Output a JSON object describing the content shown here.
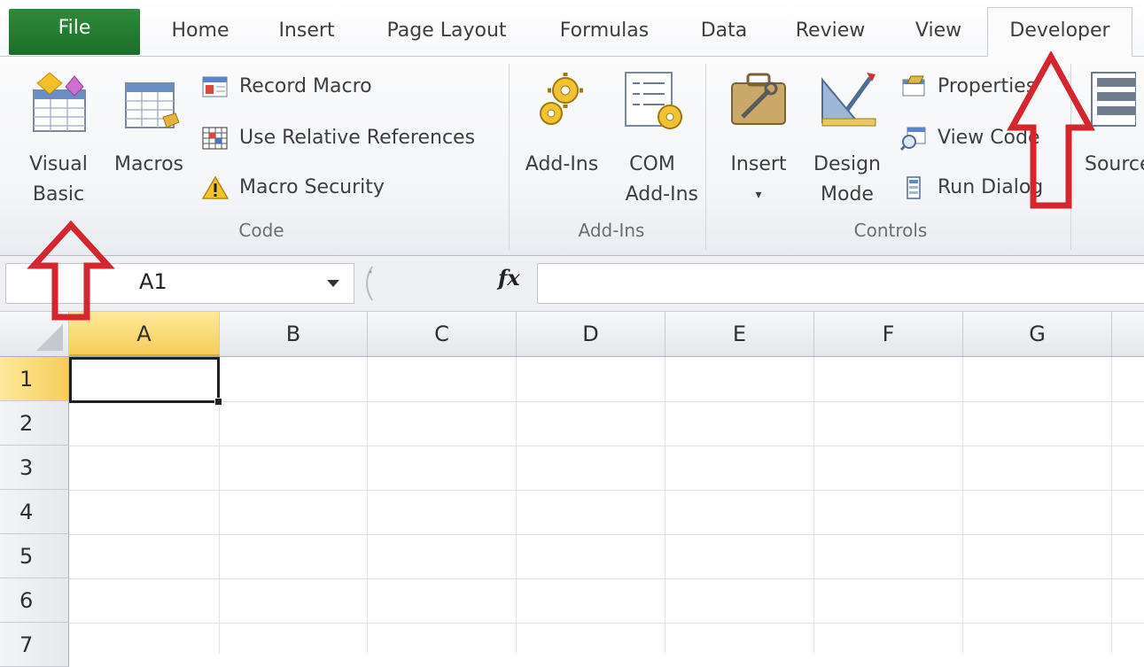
{
  "tabs": {
    "file": "File",
    "home": "Home",
    "insert": "Insert",
    "page_layout": "Page Layout",
    "formulas": "Formulas",
    "data": "Data",
    "review": "Review",
    "view": "View",
    "developer": "Developer"
  },
  "ribbon": {
    "code": {
      "label": "Code",
      "visual_basic": [
        "Visual",
        "Basic"
      ],
      "macros": "Macros",
      "record_macro": "Record Macro",
      "use_relative_references": "Use Relative References",
      "macro_security": "Macro Security"
    },
    "addins": {
      "label": "Add-Ins",
      "add_ins": "Add-Ins",
      "com_add_ins": [
        "COM",
        "Add-Ins"
      ]
    },
    "controls": {
      "label": "Controls",
      "insert": "Insert",
      "design_mode": [
        "Design",
        "Mode"
      ],
      "properties": "Properties",
      "view_code": "View Code",
      "run_dialog": "Run Dialog"
    },
    "xml": {
      "source": "Source"
    }
  },
  "formula_bar": {
    "name_box": "A1",
    "fx_label": "fx",
    "formula": ""
  },
  "sheet": {
    "columns": [
      "A",
      "B",
      "C",
      "D",
      "E",
      "F",
      "G"
    ],
    "rows": [
      "1",
      "2",
      "3",
      "4",
      "5",
      "6",
      "7"
    ],
    "active_cell": "A1"
  },
  "colors": {
    "file_tab": "#1d6e2a",
    "selected_header": "#f7cd59",
    "annotation_arrow": "#d3262e"
  },
  "icons": {
    "visual_basic": "visual-basic-icon",
    "macros": "macros-icon",
    "record_macro": "record-macro-icon",
    "relative_refs": "relative-references-icon",
    "macro_security": "warning-icon",
    "add_ins": "gears-icon",
    "com_add_ins": "com-add-ins-icon",
    "insert_controls": "toolbox-icon",
    "design_mode": "design-mode-icon",
    "properties": "properties-icon",
    "view_code": "view-code-icon",
    "run_dialog": "run-dialog-icon"
  }
}
